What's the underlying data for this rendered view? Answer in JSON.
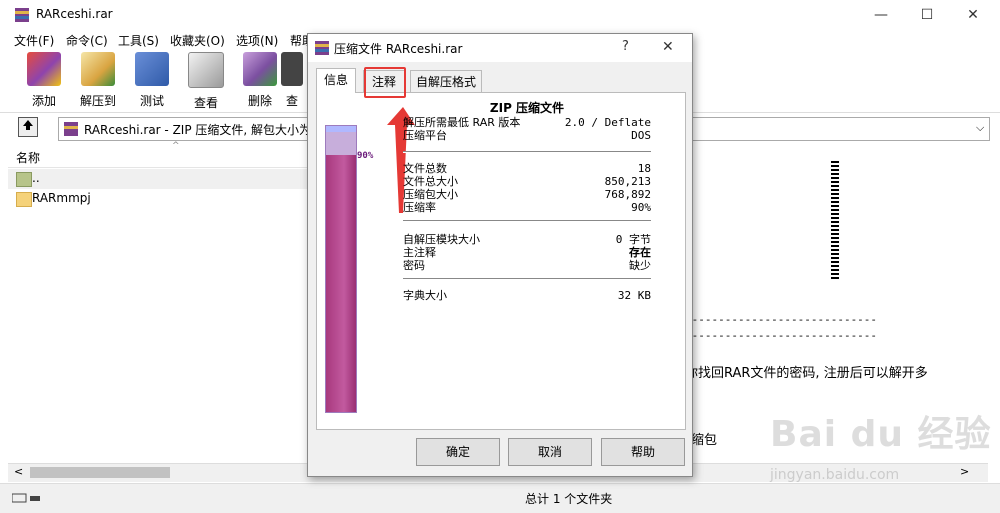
{
  "window": {
    "title": "RARceshi.rar",
    "controls": {
      "minimize": "—",
      "maximize": "☐",
      "close": "✕"
    }
  },
  "menu": [
    "文件(F)",
    "命令(C)",
    "工具(S)",
    "收藏夹(O)",
    "选项(N)",
    "帮助"
  ],
  "toolbar": [
    {
      "label": "添加",
      "icon": "add-archive-icon",
      "color": "#c0392b"
    },
    {
      "label": "解压到",
      "icon": "extract-to-icon",
      "color": "#d9a441"
    },
    {
      "label": "测试",
      "icon": "test-icon",
      "color": "#2f5aa8"
    },
    {
      "label": "查看",
      "icon": "view-icon",
      "color": "#9a9a9a"
    },
    {
      "label": "删除",
      "icon": "delete-icon",
      "color": "#7b4fa0"
    },
    {
      "label": "查",
      "icon": "find-icon",
      "color": "#444444"
    }
  ],
  "address": {
    "path": "RARceshi.rar - ZIP 压缩文件, 解包大小为 8"
  },
  "list": {
    "column_name": "名称",
    "rows": [
      {
        "name": "..",
        "icon": "parent-folder-icon"
      },
      {
        "name": "RARmmpj",
        "icon": "folder-icon"
      }
    ]
  },
  "comment": {
    "line1": "-----------------------------",
    "line2": "-----------------------------",
    "text1": "你找回RAR文件的密码, 注册后可以解开多",
    "text2": "缩包"
  },
  "status": {
    "total": "总计 1 个文件夹"
  },
  "dialog": {
    "title": "压缩文件 RARceshi.rar",
    "help_glyph": "?",
    "close_glyph": "✕",
    "tabs": [
      "信息",
      "注释",
      "自解压格式"
    ],
    "active_tab": 0,
    "highlight_tab": 1,
    "ratio_label": "90%",
    "ratio_value": 0.9,
    "archive_type": "ZIP 压缩文件",
    "props1": [
      {
        "k": "解压所需最低 RAR 版本",
        "v": "2.0 / Deflate"
      },
      {
        "k": "压缩平台",
        "v": "DOS"
      }
    ],
    "props2": [
      {
        "k": "文件总数",
        "v": "18"
      },
      {
        "k": "文件总大小",
        "v": "850,213"
      },
      {
        "k": "压缩包大小",
        "v": "768,892"
      },
      {
        "k": "压缩率",
        "v": "90%"
      }
    ],
    "props3": [
      {
        "k": "自解压模块大小",
        "v": "0 字节"
      },
      {
        "k": "主注释",
        "v": "存在"
      },
      {
        "k": "密码",
        "v": "缺少"
      }
    ],
    "props4": [
      {
        "k": "字典大小",
        "v": "32 KB"
      }
    ],
    "buttons": {
      "ok": "确定",
      "cancel": "取消",
      "help": "帮助"
    }
  },
  "watermark": {
    "brand": "Bai du 经验",
    "url": "jingyan.baidu.com"
  }
}
